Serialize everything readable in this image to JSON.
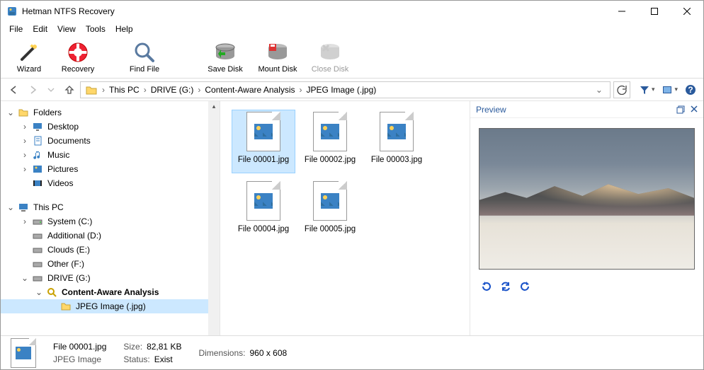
{
  "window": {
    "title": "Hetman NTFS Recovery"
  },
  "menu": {
    "file": "File",
    "edit": "Edit",
    "view": "View",
    "tools": "Tools",
    "help": "Help"
  },
  "toolbar": {
    "wizard": "Wizard",
    "recovery": "Recovery",
    "find": "Find File",
    "save": "Save Disk",
    "mount": "Mount Disk",
    "close": "Close Disk"
  },
  "breadcrumb": {
    "items": [
      "This PC",
      "DRIVE (G:)",
      "Content-Aware Analysis",
      "JPEG Image (.jpg)"
    ]
  },
  "tree": {
    "folders_root": "Folders",
    "quick": [
      "Desktop",
      "Documents",
      "Music",
      "Pictures",
      "Videos"
    ],
    "thispc_root": "This PC",
    "drives": [
      "System (C:)",
      "Additional (D:)",
      "Clouds (E:)",
      "Other (F:)",
      "DRIVE (G:)"
    ],
    "analysis": "Content-Aware Analysis",
    "jpeg": "JPEG Image (.jpg)"
  },
  "files": {
    "items": [
      "File 00001.jpg",
      "File 00002.jpg",
      "File 00003.jpg",
      "File 00004.jpg",
      "File 00005.jpg"
    ]
  },
  "preview": {
    "title": "Preview"
  },
  "status": {
    "name": "File 00001.jpg",
    "type": "JPEG Image",
    "size_k": "Size:",
    "size_v": "82,81 KB",
    "status_k": "Status:",
    "status_v": "Exist",
    "dim_k": "Dimensions:",
    "dim_v": "960 x 608"
  }
}
